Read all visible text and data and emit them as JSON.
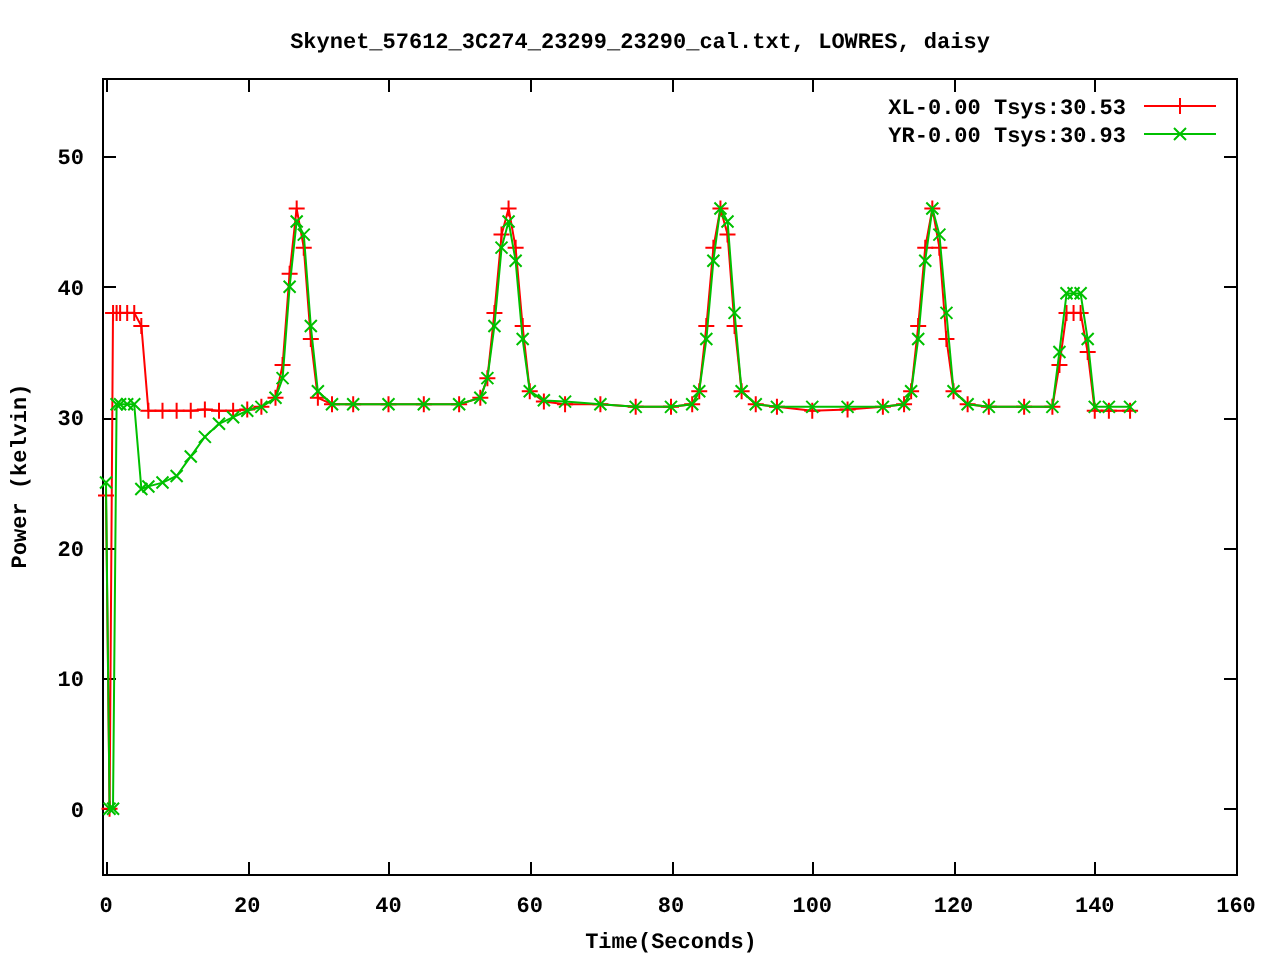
{
  "plot": {
    "chart_data": {
      "type": "line",
      "title": "Skynet_57612_3C274_23299_23290_cal.txt, LOWRES, daisy",
      "xlabel": "Time(Seconds)",
      "ylabel": "Power (kelvin)",
      "x": [
        0,
        0.5,
        1,
        1.5,
        2,
        3,
        4,
        5,
        6,
        8,
        10,
        12,
        14,
        16,
        18,
        20,
        22,
        24,
        25,
        26,
        27,
        28,
        29,
        30,
        32,
        35,
        40,
        45,
        50,
        53,
        54,
        55,
        56,
        57,
        58,
        59,
        60,
        62,
        65,
        70,
        75,
        80,
        83,
        84,
        85,
        86,
        87,
        88,
        89,
        90,
        92,
        95,
        100,
        105,
        110,
        113,
        114,
        115,
        116,
        117,
        118,
        119,
        120,
        122,
        125,
        130,
        134,
        135,
        136,
        137,
        138,
        139,
        140,
        142,
        145
      ],
      "series": [
        {
          "name": "XL-0.00 Tsys:30.53",
          "color": "#ff0000",
          "marker": "plus",
          "values": [
            24,
            0,
            38,
            38,
            38,
            38,
            38,
            37,
            30.5,
            30.5,
            30.5,
            30.5,
            30.6,
            30.5,
            30.5,
            30.6,
            30.8,
            31.5,
            34,
            41,
            46,
            43,
            36,
            31.5,
            31,
            31,
            31,
            31,
            31,
            31.5,
            33,
            38,
            44,
            46,
            43,
            37,
            32,
            31.2,
            31,
            31,
            30.8,
            30.8,
            31,
            32,
            37,
            43,
            46,
            44,
            37,
            32,
            31,
            30.8,
            30.5,
            30.6,
            30.8,
            31,
            32,
            37,
            43,
            46,
            43,
            36,
            32,
            31,
            30.8,
            30.8,
            30.8,
            34,
            38,
            38,
            38,
            35,
            30.5,
            30.5,
            30.5
          ]
        },
        {
          "name": "YR-0.00 Tsys:30.93",
          "color": "#00c000",
          "marker": "cross",
          "values": [
            25,
            0,
            0,
            31,
            31,
            31,
            31,
            24.5,
            24.7,
            25,
            25.5,
            27,
            28.5,
            29.5,
            30,
            30.5,
            30.8,
            31.5,
            33,
            40,
            45,
            44,
            37,
            32,
            31,
            31,
            31,
            31,
            31,
            31.5,
            33,
            37,
            43,
            45,
            42,
            36,
            32,
            31.3,
            31.2,
            31,
            30.8,
            30.8,
            31,
            32,
            36,
            42,
            46,
            45,
            38,
            32,
            31,
            30.8,
            30.8,
            30.8,
            30.8,
            31,
            32,
            36,
            42,
            46,
            44,
            38,
            32,
            31,
            30.8,
            30.8,
            30.8,
            35,
            39.5,
            39.5,
            39.5,
            36,
            30.8,
            30.8,
            30.8
          ]
        }
      ],
      "legend": true,
      "xlim": [
        0,
        160
      ],
      "ylim": [
        -5,
        56
      ],
      "xticks": [
        0,
        20,
        40,
        60,
        80,
        100,
        120,
        140,
        160
      ],
      "yticks": [
        0,
        10,
        20,
        30,
        40,
        50
      ]
    }
  }
}
